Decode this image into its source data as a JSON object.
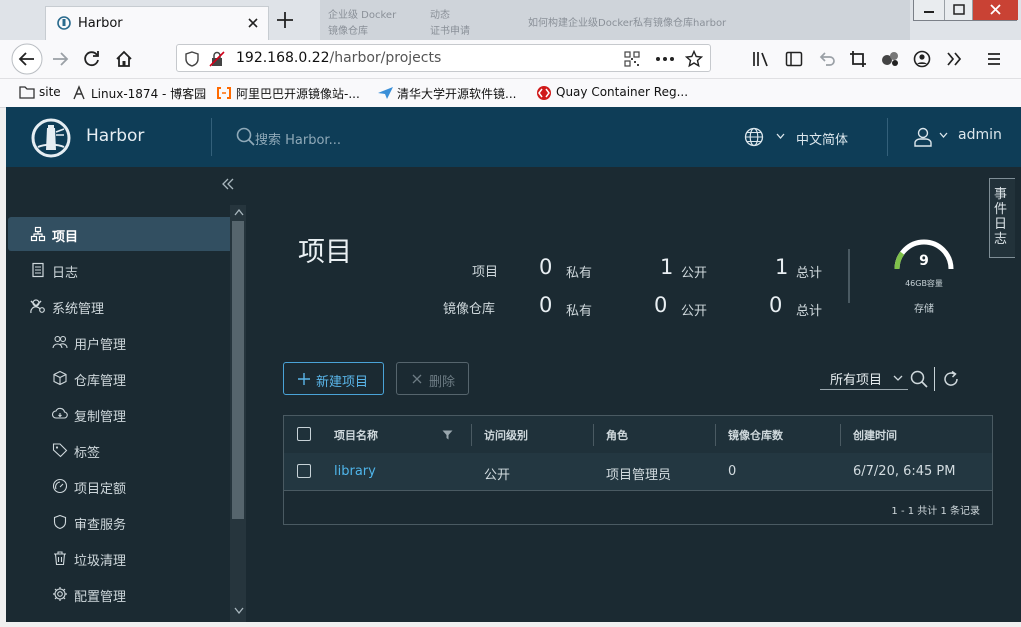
{
  "browser": {
    "tab_title": "Harbor",
    "url_host": "192.168.0.22",
    "url_path": "/harbor/projects",
    "bookmarks": [
      {
        "label": "site",
        "icon": "folder-icon"
      },
      {
        "label": "Linux-1874 - 博客园",
        "icon": "blog-icon"
      },
      {
        "label": "阿里巴巴开源镜像站-...",
        "icon": "aliyun-icon"
      },
      {
        "label": "清华大学开源软件镜...",
        "icon": "tsinghua-icon"
      },
      {
        "label": "Quay Container Reg...",
        "icon": "quay-icon"
      }
    ],
    "bg_window_text_1": "企业级 Docker",
    "bg_window_text_2": "镜像仓库",
    "bg_window_text_3": "动态",
    "bg_window_text_4": "证书申请",
    "bg_window_text_5": "如何构建企业级Docker私有镜像仓库harbor"
  },
  "header": {
    "app_name": "Harbor",
    "search_placeholder": "搜索 Harbor...",
    "language": "中文简体",
    "user": "admin"
  },
  "sidebar": {
    "items": [
      {
        "label": "项目",
        "icon": "projects-icon",
        "active": true
      },
      {
        "label": "日志",
        "icon": "logs-icon"
      },
      {
        "label": "系统管理",
        "icon": "admin-icon",
        "expanded": true
      },
      {
        "label": "用户管理",
        "icon": "users-icon"
      },
      {
        "label": "仓库管理",
        "icon": "registries-icon"
      },
      {
        "label": "复制管理",
        "icon": "replication-icon"
      },
      {
        "label": "标签",
        "icon": "tag-icon"
      },
      {
        "label": "项目定额",
        "icon": "quota-icon"
      },
      {
        "label": "审查服务",
        "icon": "shield-icon"
      },
      {
        "label": "垃圾清理",
        "icon": "trash-icon"
      },
      {
        "label": "配置管理",
        "icon": "gear-icon"
      }
    ]
  },
  "main": {
    "title": "项目",
    "stats": {
      "row1_label": "项目",
      "row2_label": "镜像仓库",
      "private_label": "私有",
      "public_label": "公开",
      "total_label": "总计",
      "projects_private": "0",
      "projects_public": "1",
      "projects_total": "1",
      "repos_private": "0",
      "repos_public": "0",
      "repos_total": "0"
    },
    "storage": {
      "value": "9",
      "caption": "46GB容量",
      "label": "存储",
      "used_fraction": 0.2
    },
    "event_log_tab": "事件日志",
    "buttons": {
      "new_project": "新建项目",
      "delete": "删除"
    },
    "filter": {
      "selected": "所有项目"
    },
    "grid": {
      "columns": [
        "项目名称",
        "访问级别",
        "角色",
        "镜像仓库数",
        "创建时间"
      ],
      "rows": [
        {
          "name": "library",
          "access": "公开",
          "role": "项目管理员",
          "repo_count": "0",
          "created": "6/7/20, 6:45 PM"
        }
      ],
      "footer": "1 - 1 共计 1 条记录"
    }
  },
  "colors": {
    "header_bg": "#0e3d57",
    "content_bg": "#1b2a32",
    "accent": "#4fb5ea",
    "gauge": "#7fc14a"
  }
}
